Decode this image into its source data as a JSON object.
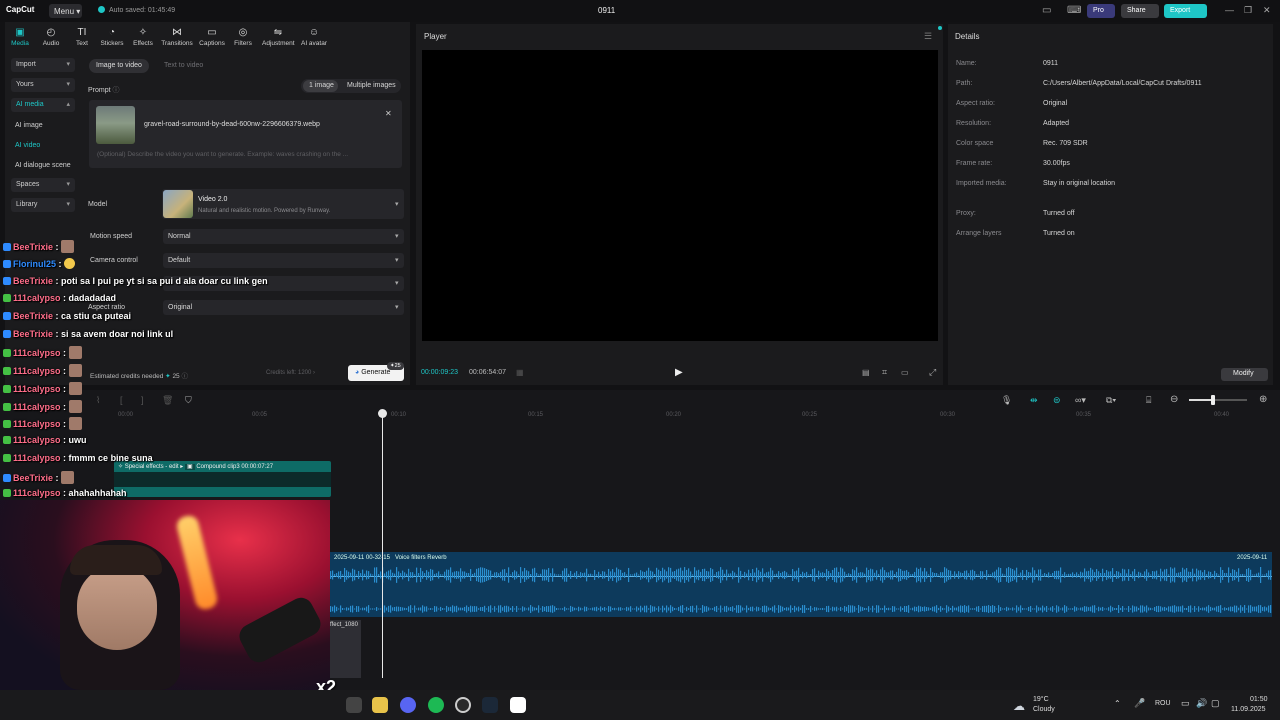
{
  "titlebar": {
    "logo": "CapCut",
    "menu": "Menu",
    "autosave": "Auto saved: 01:45:49",
    "project": "0911",
    "pro": "Pro",
    "share": "Share",
    "export": "Export"
  },
  "toolbar": {
    "items": [
      {
        "label": "Media",
        "icon": "▣"
      },
      {
        "label": "Audio",
        "icon": "◴"
      },
      {
        "label": "Text",
        "icon": "TI"
      },
      {
        "label": "Stickers",
        "icon": "◔"
      },
      {
        "label": "Effects",
        "icon": "✧"
      },
      {
        "label": "Transitions",
        "icon": "⋈"
      },
      {
        "label": "Captions",
        "icon": "▭"
      },
      {
        "label": "Filters",
        "icon": "◎"
      },
      {
        "label": "Adjustment",
        "icon": "⇋"
      },
      {
        "label": "AI avatar",
        "icon": "☺"
      }
    ]
  },
  "sidebar": {
    "import": "Import",
    "yours": "Yours",
    "ai_media": "AI media",
    "ai_image": "AI image",
    "ai_video": "AI video",
    "ai_dialogue": "AI dialogue scene",
    "spaces": "Spaces",
    "library": "Library"
  },
  "generator": {
    "tab_image": "Image to video",
    "tab_text": "Text to video",
    "prompt": "Prompt",
    "one_image": "1 image",
    "multi_images": "Multiple images",
    "filename": "gravel-road-surround-by-dead-600nw-2296606379.webp",
    "placeholder": "(Optional) Describe the video you want to generate. Example: waves crashing on the ...",
    "model_label": "Model",
    "model_name": "Video 2.0",
    "model_desc": "Natural and realistic motion. Powered by Runway.",
    "motion_label": "Motion speed",
    "motion_value": "Normal",
    "camera_label": "Camera control",
    "camera_value": "Default",
    "aspect_label": "Aspect ratio",
    "aspect_value": "Original",
    "credits_label": "Estimated credits needed",
    "credits_value": "25",
    "credits_left": "Credits left: 1200",
    "generate": "Generate",
    "generate_badge": "25"
  },
  "player": {
    "title": "Player",
    "current_time": "00:00:09:23",
    "total_time": "00:06:54:07"
  },
  "details": {
    "title": "Details",
    "rows": [
      {
        "k": "Name:",
        "v": "0911"
      },
      {
        "k": "Path:",
        "v": "C:/Users/Albert/AppData/Local/CapCut Drafts/0911"
      },
      {
        "k": "Aspect ratio:",
        "v": "Original"
      },
      {
        "k": "Resolution:",
        "v": "Adapted"
      },
      {
        "k": "Color space",
        "v": "Rec. 709 SDR"
      },
      {
        "k": "Frame rate:",
        "v": "30.00fps"
      },
      {
        "k": "Imported media:",
        "v": "Stay in original location"
      },
      {
        "k": "Proxy:",
        "v": "Turned off"
      },
      {
        "k": "Arrange layers",
        "v": "Turned on"
      }
    ],
    "modify": "Modify"
  },
  "timeline": {
    "ticks": [
      "00:00",
      "00:05",
      "00:10",
      "00:15",
      "00:20",
      "00:25",
      "00:30",
      "00:35",
      "00:40"
    ],
    "clip1_label": "Special effects - edit",
    "clip1_compound": "Compound clip3",
    "clip1_time": "00:00:07:27",
    "audio_label": "2025-09-11 00-32-15",
    "audio_filter": "Voice filters Reverb",
    "audio_label_end": "2025-09-11",
    "fx_clip": "Effect_1080"
  },
  "chat": [
    {
      "user": "BeeTrixie",
      "msg": "",
      "color": "#ff6e8a",
      "emote": true
    },
    {
      "user": "Florinul25",
      "msg": "",
      "color": "#2e8bff",
      "emoji": true
    },
    {
      "user": "BeeTrixie",
      "msg": "poti sa I pui pe yt si sa pui d ala doar cu link gen",
      "color": "#ff6e8a"
    },
    {
      "user": "111calypso",
      "msg": "dadadadad",
      "color": "#ff6e8a"
    },
    {
      "user": "BeeTrixie",
      "msg": "ca stiu ca puteai",
      "color": "#ff6e8a"
    },
    {
      "user": "BeeTrixie",
      "msg": "si sa avem doar noi link ul",
      "color": "#ff6e8a"
    },
    {
      "user": "111calypso",
      "msg": "",
      "color": "#ff6e8a",
      "emote": true
    },
    {
      "user": "111calypso",
      "msg": "",
      "color": "#ff6e8a",
      "emote": true
    },
    {
      "user": "111calypso",
      "msg": "",
      "color": "#ff6e8a",
      "emote": true
    },
    {
      "user": "111calypso",
      "msg": "",
      "color": "#ff6e8a",
      "emote": true
    },
    {
      "user": "111calypso",
      "msg": "",
      "color": "#ff6e8a",
      "emote": true
    },
    {
      "user": "111calypso",
      "msg": "uwu",
      "color": "#ff6e8a"
    },
    {
      "user": "111calypso",
      "msg": "fmmm ce bine suna",
      "color": "#ff6e8a"
    },
    {
      "user": "BeeTrixie",
      "msg": "",
      "color": "#ff6e8a",
      "emote": true
    },
    {
      "user": "111calypso",
      "msg": "ahahahhahah",
      "color": "#ff6e8a"
    }
  ],
  "overlay": {
    "multiplier": "x2"
  },
  "taskbar": {
    "temp": "19°C",
    "weather": "Cloudy",
    "lang": "ROU",
    "time": "01:50",
    "date": "11.09.2025"
  },
  "colors": {
    "accent": "#1ec6c6",
    "pro": "#3a3a7a",
    "audio_wave": "#2a8fd0"
  }
}
